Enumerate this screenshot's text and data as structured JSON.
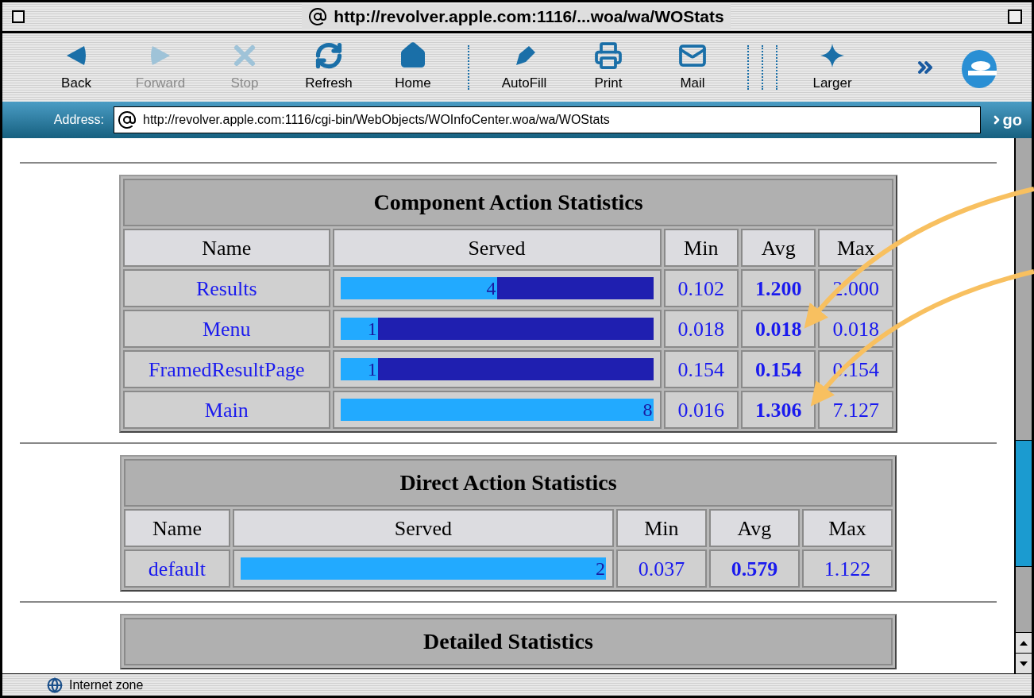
{
  "window": {
    "title": "http://revolver.apple.com:1116/...woa/wa/WOStats"
  },
  "toolbar_groups": [
    [
      {
        "kind": "back",
        "label": "Back",
        "disabled": false
      },
      {
        "kind": "forward",
        "label": "Forward",
        "disabled": true
      },
      {
        "kind": "stop",
        "label": "Stop",
        "disabled": true
      },
      {
        "kind": "refresh",
        "label": "Refresh",
        "disabled": false
      },
      {
        "kind": "home",
        "label": "Home",
        "disabled": false
      }
    ],
    [
      {
        "kind": "autofill",
        "label": "AutoFill",
        "disabled": false
      },
      {
        "kind": "print",
        "label": "Print",
        "disabled": false
      },
      {
        "kind": "mail",
        "label": "Mail",
        "disabled": false
      }
    ],
    [
      {
        "kind": "larger",
        "label": "Larger",
        "disabled": false
      }
    ]
  ],
  "address": {
    "label": "Address:",
    "value": "http://revolver.apple.com:1116/cgi-bin/WebObjects/WOInfoCenter.woa/wa/WOStats",
    "go": "go"
  },
  "tables": [
    {
      "title": "Component Action Statistics",
      "columns": [
        "Name",
        "Served",
        "Min",
        "Avg",
        "Max"
      ],
      "rows": [
        {
          "name": "Results",
          "served": "4",
          "level": 0.5,
          "min": "0.102",
          "avg": "1.200",
          "max": "2.000"
        },
        {
          "name": "Menu",
          "served": "1",
          "level": 0.12,
          "min": "0.018",
          "avg": "0.018",
          "max": "0.018"
        },
        {
          "name": "FramedResultPage",
          "served": "1",
          "level": 0.12,
          "min": "0.154",
          "avg": "0.154",
          "max": "0.154"
        },
        {
          "name": "Main",
          "served": "8",
          "level": 1.0,
          "min": "0.016",
          "avg": "1.306",
          "max": "7.127"
        }
      ]
    },
    {
      "title": "Direct Action Statistics",
      "columns": [
        "Name",
        "Served",
        "Min",
        "Avg",
        "Max"
      ],
      "rows": [
        {
          "name": "default",
          "served": "2",
          "level": 1.0,
          "min": "0.037",
          "avg": "0.579",
          "max": "1.122"
        }
      ]
    },
    {
      "title": "Detailed Statistics"
    }
  ],
  "status_bar": {
    "text": "Internet zone"
  }
}
